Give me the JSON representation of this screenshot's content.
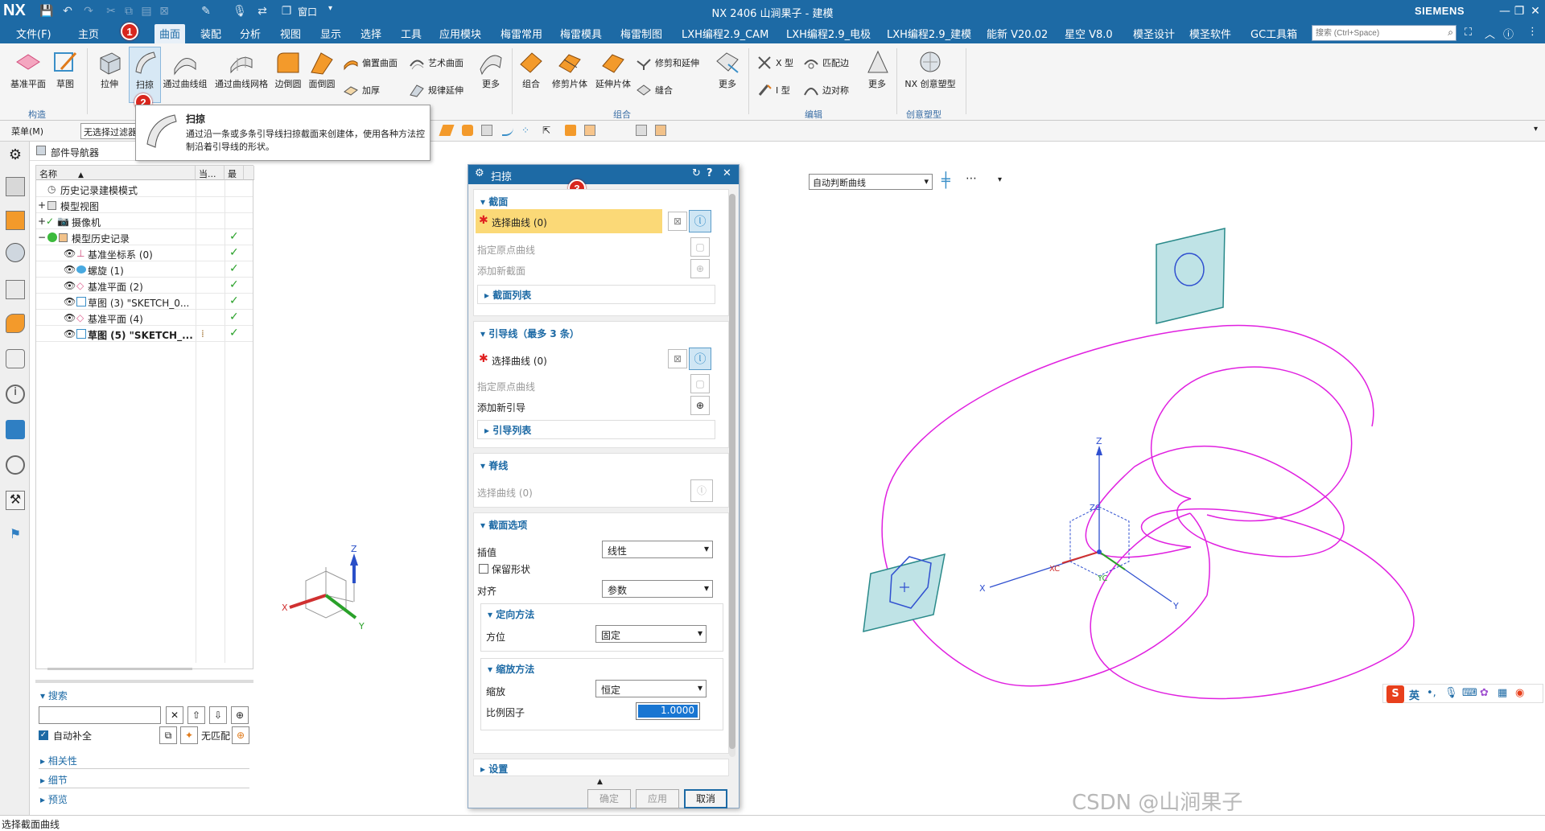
{
  "titlebar": {
    "logo": "NX",
    "title": "NX 2406 山涧果子 - 建模",
    "brand": "SIEMENS",
    "window_menu": "窗口",
    "min": "—",
    "restore": "❐",
    "close": "✕"
  },
  "menubar": {
    "items": [
      "文件(F)",
      "主页",
      "曲面",
      "装配",
      "分析",
      "视图",
      "显示",
      "选择",
      "工具",
      "应用模块",
      "梅雷常用",
      "梅雷模具",
      "梅雷制图",
      "LXH编程2.9_CAM",
      "LXH编程2.9_电极",
      "LXH编程2.9_建模",
      "能新 V20.02",
      "星空 V8.0",
      "模圣设计",
      "模圣软件",
      "GC工具箱"
    ],
    "active_index": 2,
    "search_placeholder": "搜索 (Ctrl+Space)"
  },
  "badges": {
    "b1": "1",
    "b2": "2",
    "b3": "3"
  },
  "ribbon": {
    "large": [
      "基准平面",
      "草图",
      "拉伸",
      "扫掠",
      "通过曲线组",
      "通过曲线网格",
      "边倒圆",
      "面倒圆"
    ],
    "offset": "偏置曲面",
    "thicken": "加厚",
    "studio": "艺术曲面",
    "extend": "规律延伸",
    "more1": "更多",
    "combine": "组合",
    "trim_sheet": "修剪片体",
    "extend_sheet": "延伸片体",
    "trim_extend": "修剪和延伸",
    "sew": "缝合",
    "more2": "更多",
    "x_type": "X 型",
    "i_type": "I 型",
    "match_edge": "匹配边",
    "edge_sym": "边对称",
    "more3": "更多",
    "nx_creative": "NX 创意塑型",
    "groups": [
      "构造",
      "组合",
      "编辑",
      "创意塑型"
    ]
  },
  "tooltip": {
    "title": "扫掠",
    "body": "通过沿一条或多条引导线扫掠截面来创建体，使用各种方法控制沿着引导线的形状。"
  },
  "toolbar2": {
    "menu": "菜单(M)",
    "filter": "无选择过滤器",
    "curve_rule": "自动判断曲线"
  },
  "navigator": {
    "title": "部件导航器",
    "col_name": "名称",
    "col_current": "当...",
    "col_latest": "最",
    "rows": [
      {
        "label": "历史记录建模模式",
        "check": ""
      },
      {
        "label": "模型视图",
        "check": ""
      },
      {
        "label": "摄像机",
        "check": ""
      },
      {
        "label": "模型历史记录",
        "check": "✓"
      },
      {
        "label": "基准坐标系 (0)",
        "check": "✓"
      },
      {
        "label": "螺旋 (1)",
        "check": "✓"
      },
      {
        "label": "基准平面 (2)",
        "check": "✓"
      },
      {
        "label": "草图 (3) \"SKETCH_0...",
        "check": "✓"
      },
      {
        "label": "基准平面 (4)",
        "check": "✓"
      },
      {
        "label": "草图 (5) \"SKETCH_...",
        "check": "✓"
      }
    ],
    "search_title": "搜索",
    "auto_complete": "自动补全",
    "no_match": "无匹配",
    "relevance": "相关性",
    "details": "细节",
    "preview": "预览"
  },
  "dialog": {
    "title": "扫掠",
    "section": "截面",
    "select_curve_section": "选择曲线 (0)",
    "specify_origin_section": "指定原点曲线",
    "add_new_section": "添加新截面",
    "section_list": "截面列表",
    "guides": "引导线（最多 3 条）",
    "select_curve_guide": "选择曲线 (0)",
    "specify_origin_guide": "指定原点曲线",
    "add_new_guide": "添加新引导",
    "guide_list": "引导列表",
    "spine": "脊线",
    "select_curve_spine": "选择曲线 (0)",
    "section_options": "截面选项",
    "interpolation_label": "插值",
    "interpolation_value": "线性",
    "preserve_shape": "保留形状",
    "alignment_label": "对齐",
    "alignment_value": "参数",
    "orientation_method": "定向方法",
    "orientation_label": "方位",
    "orientation_value": "固定",
    "scaling_method": "缩放方法",
    "scaling_label": "缩放",
    "scaling_value": "恒定",
    "scale_factor_label": "比例因子",
    "scale_factor_value": "1.0000",
    "settings": "设置",
    "ok": "确定",
    "apply": "应用",
    "cancel": "取消"
  },
  "axes": {
    "x": "X",
    "y": "Y",
    "z": "Z",
    "xc": "XC",
    "yc": "YC",
    "zc": "ZC"
  },
  "ime": {
    "lang": "英"
  },
  "watermark": "CSDN @山涧果子",
  "status": "选择截面曲线",
  "colors": {
    "accent": "#1d6aa5",
    "highlight": "#fbd977",
    "helix": "#e020e0",
    "plane": "#bfe3e6",
    "required": "#e02020"
  }
}
